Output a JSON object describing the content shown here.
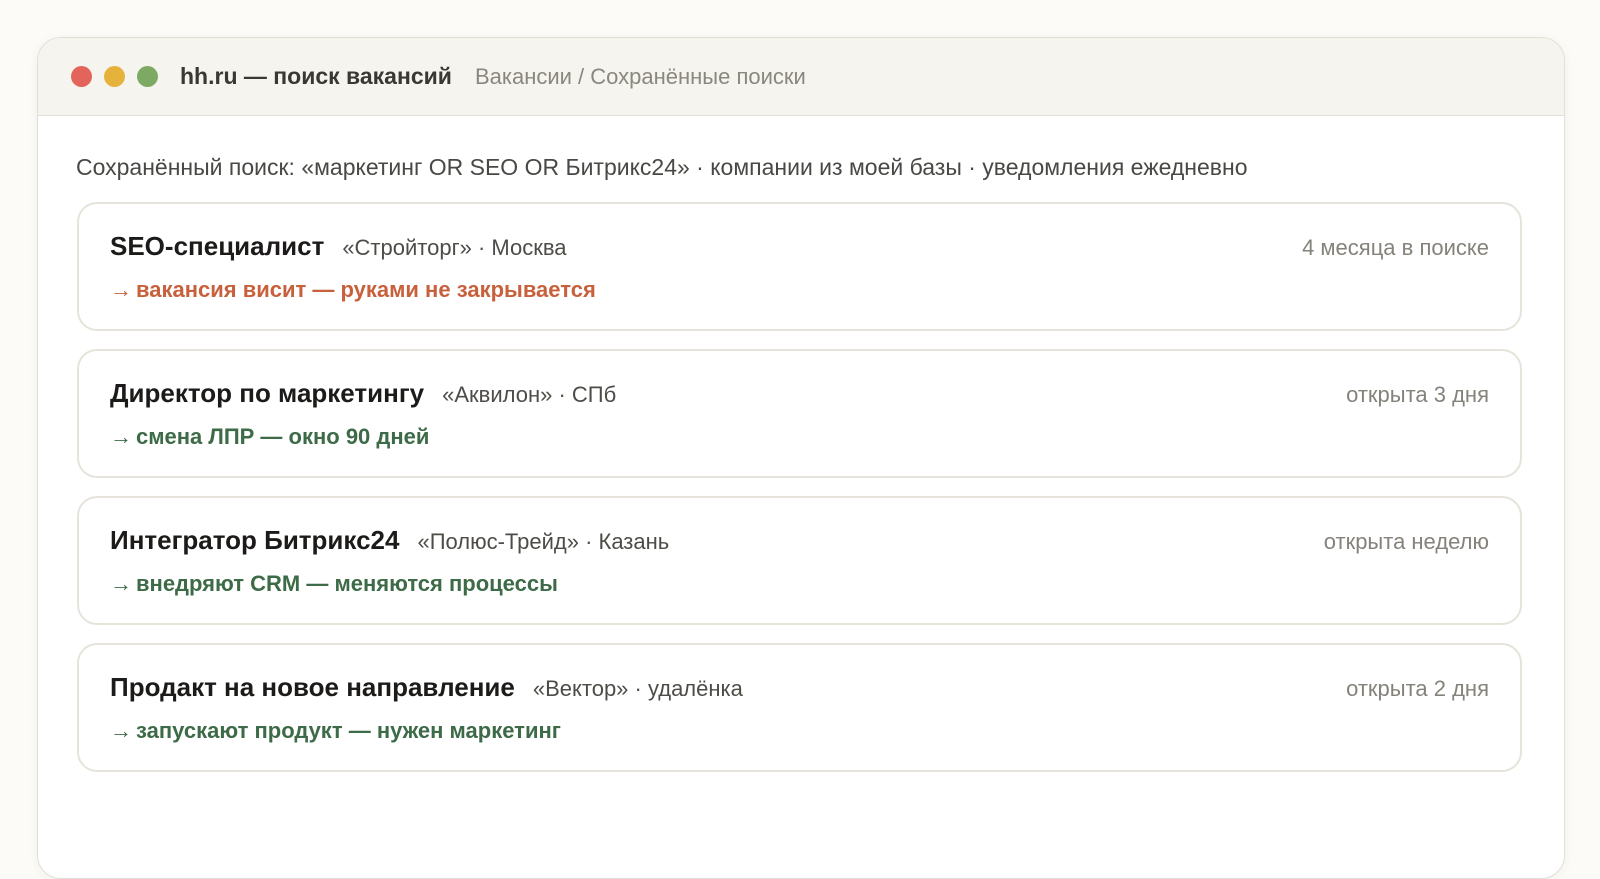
{
  "window": {
    "app_title": "hh.ru — поиск вакансий",
    "breadcrumb": "Вакансии / Сохранённые поиски"
  },
  "saved_search": "Сохранённый поиск: «маркетинг OR SEO OR Битрикс24» · компании из моей базы · уведомления ежедневно",
  "icons": {
    "arrow": "→"
  },
  "colors": {
    "warn": "#c8603c",
    "good": "#3d6a47",
    "close": "#e2645a",
    "minimize": "#e5b33c",
    "maximize": "#7caa63"
  },
  "vacancies": [
    {
      "title": "SEO-специалист",
      "meta": "«Стройторг» · Москва",
      "time": "4 месяца в поиске",
      "signal": "вакансия висит — руками не закрывается"
    },
    {
      "title": "Директор по маркетингу",
      "meta": "«Аквилон» · СПб",
      "time": "открыта 3 дня",
      "signal": "смена ЛПР — окно 90 дней"
    },
    {
      "title": "Интегратор Битрикс24",
      "meta": "«Полюс-Трейд» · Казань",
      "time": "открыта неделю",
      "signal": "внедряют CRM — меняются процессы"
    },
    {
      "title": "Продакт на новое направление",
      "meta": "«Вектор» · удалёнка",
      "time": "открыта 2 дня",
      "signal": "запускают продукт — нужен маркетинг"
    }
  ]
}
